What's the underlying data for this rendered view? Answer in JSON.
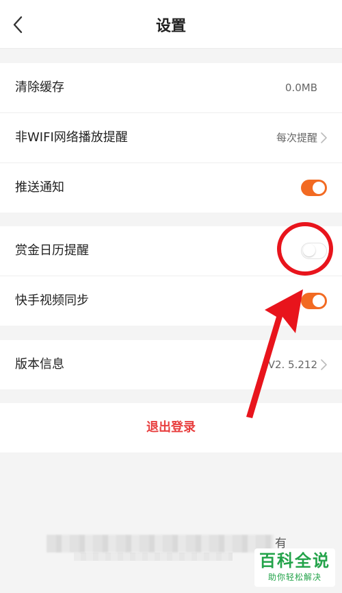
{
  "header": {
    "title": "设置"
  },
  "groups": [
    {
      "items": [
        {
          "label": "清除缓存",
          "value": "0.0MB"
        },
        {
          "label": "非WIFI网络播放提醒",
          "value": "每次提醒"
        },
        {
          "label": "推送通知",
          "toggle": "on"
        }
      ]
    },
    {
      "items": [
        {
          "label": "赏金日历提醒",
          "toggle": "off"
        },
        {
          "label": "快手视频同步",
          "toggle": "on"
        }
      ]
    },
    {
      "items": [
        {
          "label": "版本信息",
          "value": "V2.  5.212"
        }
      ]
    }
  ],
  "logout": {
    "label": "退出登录"
  },
  "footer": {
    "visible_char": "有"
  },
  "watermark": {
    "main": "百科全说",
    "sub": "助你轻松解决"
  },
  "colors": {
    "accent": "#f26a22",
    "logout": "#e83e3e",
    "annotation": "#e8141c",
    "watermark": "#23a34a"
  }
}
